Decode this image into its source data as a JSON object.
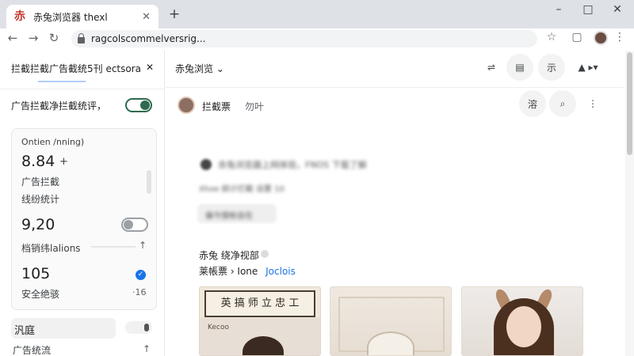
{
  "browser": {
    "tab": {
      "favicon": "赤",
      "title": "赤兔浏览器 thexl"
    },
    "url": "ragcolscommelversrig...",
    "colors": {
      "tab_strip": "#dee1e6",
      "accent": "#1a73e8",
      "toggle_on": "#2f6b4e"
    },
    "window_controls": {
      "minimize": "–",
      "maximize": "□",
      "close": "✕"
    }
  },
  "sidepanel": {
    "header": "拦截拦截广告截统5刊 ectsora",
    "close_glyph": "✕",
    "toggle_label": "广告拦截净拦截统评，",
    "card": {
      "label1": "Ontien /nning)",
      "value1": "8.84",
      "value1_suffix": "+",
      "line2": "广告拦截",
      "line3": "线纷统计",
      "value2": "9,20",
      "line4": "档销纬lalions",
      "value3": "105",
      "line5": "安全绝骇",
      "small_num": "·16"
    },
    "bottom_label": "汎庭",
    "last_label": "广告统流"
  },
  "main": {
    "title": "赤兔浏览",
    "toolbar_buttons": [
      "⇌",
      "▤",
      "示",
      "▲ ▸▾"
    ],
    "profile": {
      "name": "拦截票",
      "tag": "勿叶",
      "buttons": [
        "溶",
        "⌕",
        "⋮"
      ]
    },
    "blurred": {
      "line1": "赤兔浏览器上网体验，FNOS 下载了解",
      "line2": "Xhoe 统计拦截     设置    10",
      "button": "偏今搜帐自在"
    },
    "section": {
      "title": "赤兔 绕净视部",
      "subtitle": "莱帳票 › Ione",
      "link": "Joclois"
    },
    "tiles": [
      {
        "sign": "英 搞 师 立 忠 工",
        "subsign": "Kecoo"
      },
      {
        "caption": ""
      },
      {
        "caption": ""
      }
    ]
  }
}
